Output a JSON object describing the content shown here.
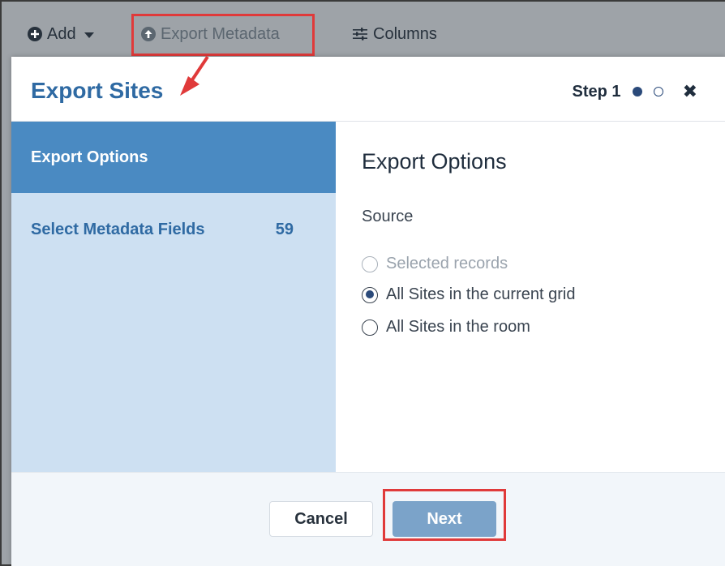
{
  "toolbar": {
    "add_label": "Add",
    "export_label": "Export Metadata",
    "columns_label": "Columns"
  },
  "modal": {
    "title": "Export Sites",
    "step_label": "Step 1",
    "close_glyph": "✖"
  },
  "sidebar": {
    "items": [
      {
        "label": "Export Options",
        "count": ""
      },
      {
        "label": "Select Metadata Fields",
        "count": "59"
      }
    ]
  },
  "content": {
    "title": "Export Options",
    "source_label": "Source",
    "options": [
      {
        "label": "Selected records",
        "state": "disabled"
      },
      {
        "label": "All Sites in the current grid",
        "state": "checked"
      },
      {
        "label": "All Sites in the room",
        "state": "unchecked"
      }
    ]
  },
  "footer": {
    "cancel_label": "Cancel",
    "next_label": "Next"
  },
  "colors": {
    "accent": "#2f6aa3",
    "sidebar_active": "#4a8ac2",
    "sidebar_bg": "#cde0f2",
    "annotation_red": "#e03a3a"
  }
}
